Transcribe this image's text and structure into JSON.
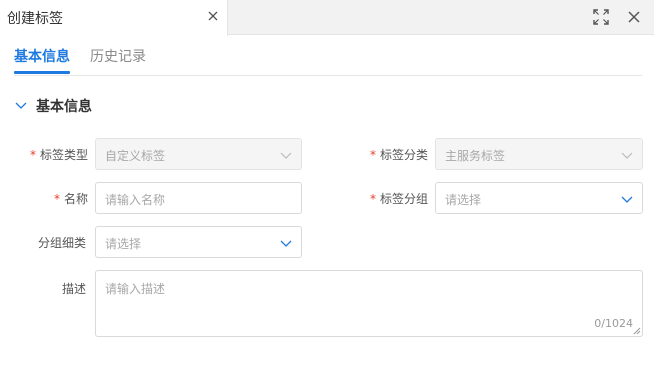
{
  "window": {
    "tab_title": "创建标签",
    "close_icon": "close-icon",
    "maximize_icon": "fullscreen-icon",
    "window_close_icon": "close-icon"
  },
  "subtabs": [
    {
      "label": "基本信息",
      "active": true
    },
    {
      "label": "历史记录",
      "active": false
    }
  ],
  "section": {
    "title": "基本信息",
    "icon": "chevron-down-icon"
  },
  "form": {
    "tag_type": {
      "label": "标签类型",
      "required": true,
      "placeholder": "自定义标签",
      "disabled": true
    },
    "tag_category": {
      "label": "标签分类",
      "required": true,
      "placeholder": "主服务标签",
      "disabled": true
    },
    "name": {
      "label": "名称",
      "required": true,
      "placeholder": "请输入名称"
    },
    "tag_group": {
      "label": "标签分组",
      "required": true,
      "placeholder": "请选择"
    },
    "group_detail": {
      "label": "分组细类",
      "required": false,
      "placeholder": "请选择"
    },
    "description": {
      "label": "描述",
      "required": false,
      "placeholder": "请输入描述",
      "counter": "0/1024"
    }
  },
  "colors": {
    "accent": "#1f7ae0",
    "required": "#e8412e"
  }
}
